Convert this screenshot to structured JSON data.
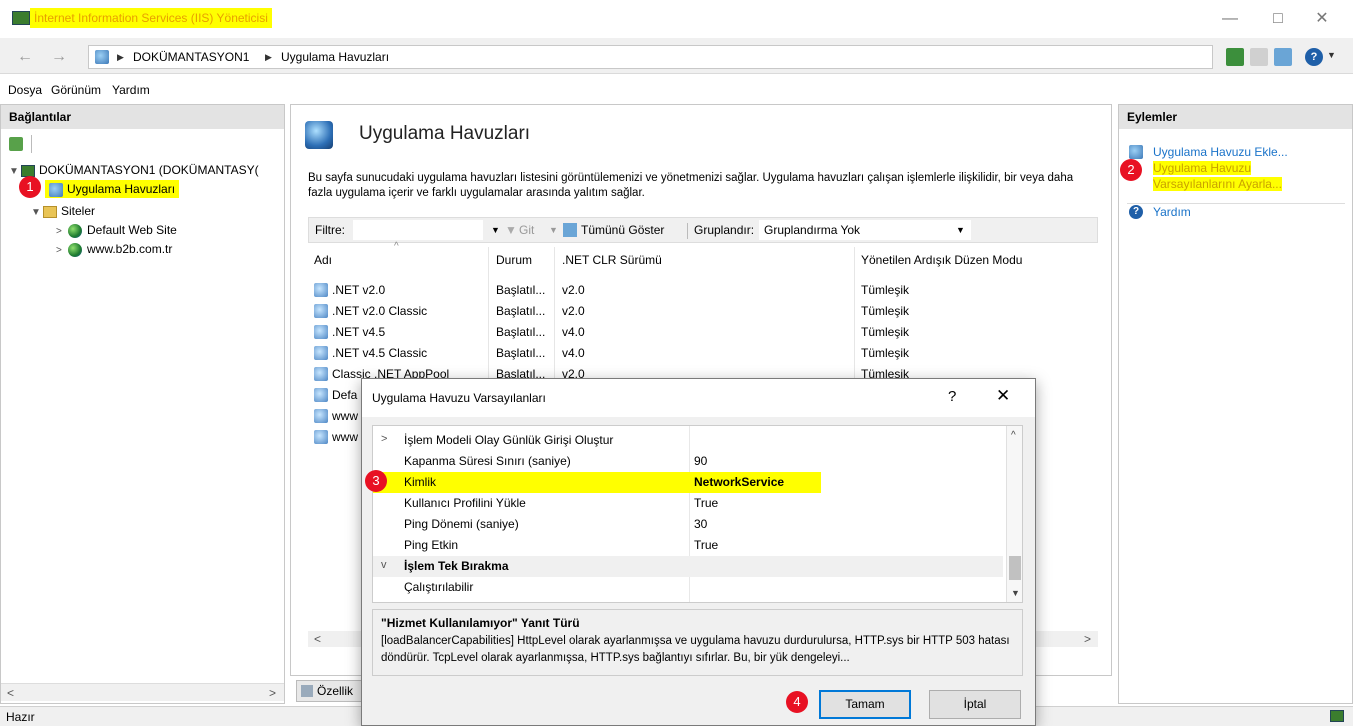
{
  "window": {
    "title": "İnternet Information Services (IIS) Yöneticisi"
  },
  "address": {
    "segments": [
      "DOKÜMANTASYON1",
      "Uygulama Havuzları"
    ]
  },
  "menu": [
    "Dosya",
    "Görünüm",
    "Yardım"
  ],
  "connections": {
    "header": "Bağlantılar",
    "server": "DOKÜMANTASYON1 (DOKÜMANTASY(",
    "app_pools": "Uygulama Havuzları",
    "sites": "Siteler",
    "site_items": [
      "Default Web Site",
      "www.b2b.com.tr"
    ]
  },
  "main": {
    "title": "Uygulama Havuzları",
    "description": "Bu sayfa sunucudaki uygulama havuzları listesini görüntülemenizi ve yönetmenizi sağlar. Uygulama havuzları çalışan işlemlerle ilişkilidir, bir veya daha fazla uygulama içerir ve farklı uygulamalar arasında yalıtım sağlar.",
    "filter_label": "Filtre:",
    "go_label": "Git",
    "show_all_label": "Tümünü Göster",
    "group_label": "Gruplandır:",
    "group_value": "Gruplandırma Yok",
    "columns": [
      "Adı",
      "Durum",
      ".NET CLR Sürümü",
      "Yönetilen Ardışık Düzen Modu"
    ],
    "rows": [
      {
        "name": ".NET v2.0",
        "status": "Başlatıl...",
        "clr": "v2.0",
        "mode": "Tümleşik"
      },
      {
        "name": ".NET v2.0 Classic",
        "status": "Başlatıl...",
        "clr": "v2.0",
        "mode": "Tümleşik"
      },
      {
        "name": ".NET v4.5",
        "status": "Başlatıl...",
        "clr": "v4.0",
        "mode": "Tümleşik"
      },
      {
        "name": ".NET v4.5 Classic",
        "status": "Başlatıl...",
        "clr": "v4.0",
        "mode": "Tümleşik"
      },
      {
        "name": "Classic .NET AppPool",
        "status": "Başlatıl...",
        "clr": "v2.0",
        "mode": "Tümleşik"
      },
      {
        "name": "Defa",
        "status": "",
        "clr": "",
        "mode": ""
      },
      {
        "name": "www",
        "status": "",
        "clr": "",
        "mode": ""
      },
      {
        "name": "www",
        "status": "",
        "clr": "",
        "mode": ""
      }
    ],
    "features_tab": "Özellik"
  },
  "actions": {
    "header": "Eylemler",
    "add_pool": "Uygulama Havuzu Ekle...",
    "set_defaults_line1": "Uygulama Havuzu",
    "set_defaults_line2": "Varsayılanlarını Ayarla...",
    "help": "Yardım"
  },
  "status": {
    "text": "Hazır"
  },
  "badges": [
    "1",
    "2",
    "3",
    "4"
  ],
  "dialog": {
    "title": "Uygulama Havuzu Varsayılanları",
    "help_glyph": "?",
    "properties": [
      {
        "key": "İşlem Modeli Olay Günlük Girişi Oluştur",
        "value": "",
        "expander": ">"
      },
      {
        "key": "Kapanma Süresi Sınırı (saniye)",
        "value": "90",
        "expander": ""
      },
      {
        "key": "Kimlik",
        "value": "NetworkService",
        "expander": ""
      },
      {
        "key": "Kullanıcı Profilini Yükle",
        "value": "True",
        "expander": ""
      },
      {
        "key": "Ping Dönemi (saniye)",
        "value": "30",
        "expander": ""
      },
      {
        "key": "Ping Etkin",
        "value": "True",
        "expander": ""
      },
      {
        "key": "İşlem Tek Bırakma",
        "value": "",
        "expander": "v"
      },
      {
        "key": "Çalıştırılabilir",
        "value": "",
        "expander": ""
      }
    ],
    "desc_title": "\"Hizmet Kullanılamıyor\" Yanıt Türü",
    "desc_text": "[loadBalancerCapabilities] HttpLevel olarak ayarlanmışsa ve uygulama havuzu durdurulursa, HTTP.sys bir HTTP 503 hatası döndürür. TcpLevel olarak ayarlanmışsa, HTTP.sys bağlantıyı sıfırlar. Bu, bir yük dengeleyi...",
    "ok": "Tamam",
    "cancel": "İptal"
  },
  "colors": {
    "highlight": "#ffff00",
    "badge": "#e81123",
    "link": "#1a73c9"
  }
}
